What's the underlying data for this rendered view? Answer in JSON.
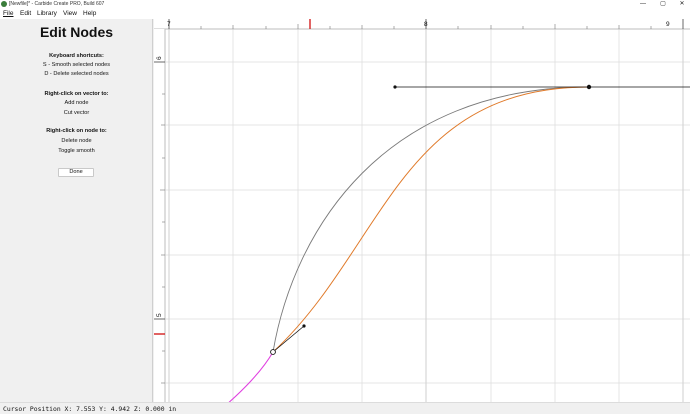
{
  "window": {
    "title": "[Newfile]* - Carbide Create PRO, Build 607",
    "min_glyph": "—",
    "max_glyph": "▢",
    "close_glyph": "✕",
    "app_icon": "carbide-logo-icon"
  },
  "menu": {
    "items": [
      {
        "label": "File"
      },
      {
        "label": "Edit"
      },
      {
        "label": "Library"
      },
      {
        "label": "View"
      },
      {
        "label": "Help"
      }
    ]
  },
  "panel": {
    "title": "Edit Nodes",
    "shortcuts_heading": "Keyboard shortcuts:",
    "shortcut_smooth": "S - Smooth selected nodes",
    "shortcut_delete": "D - Delete selected nodes",
    "vector_heading": "Right-click on vector to:",
    "vector_add_node": "Add node",
    "vector_cut": "Cut vector",
    "node_heading": "Right-click on node to:",
    "node_delete": "Delete node",
    "node_toggle": "Toggle smooth",
    "done_label": "Done"
  },
  "canvas": {
    "ruler_x_labels": [
      "7",
      "8",
      "9"
    ],
    "ruler_y_labels": [
      "6",
      "5"
    ],
    "colors": {
      "grid": "#dedede",
      "original_curve": "#7a7a7a",
      "edited_curve": "#e07a2a",
      "handle": "#111111",
      "magenta_segment": "#e040e0",
      "cursor_marker": "#d42020"
    }
  },
  "status": {
    "text": "Cursor Position X: 7.553 Y: 4.942 Z: 0.000 in"
  }
}
